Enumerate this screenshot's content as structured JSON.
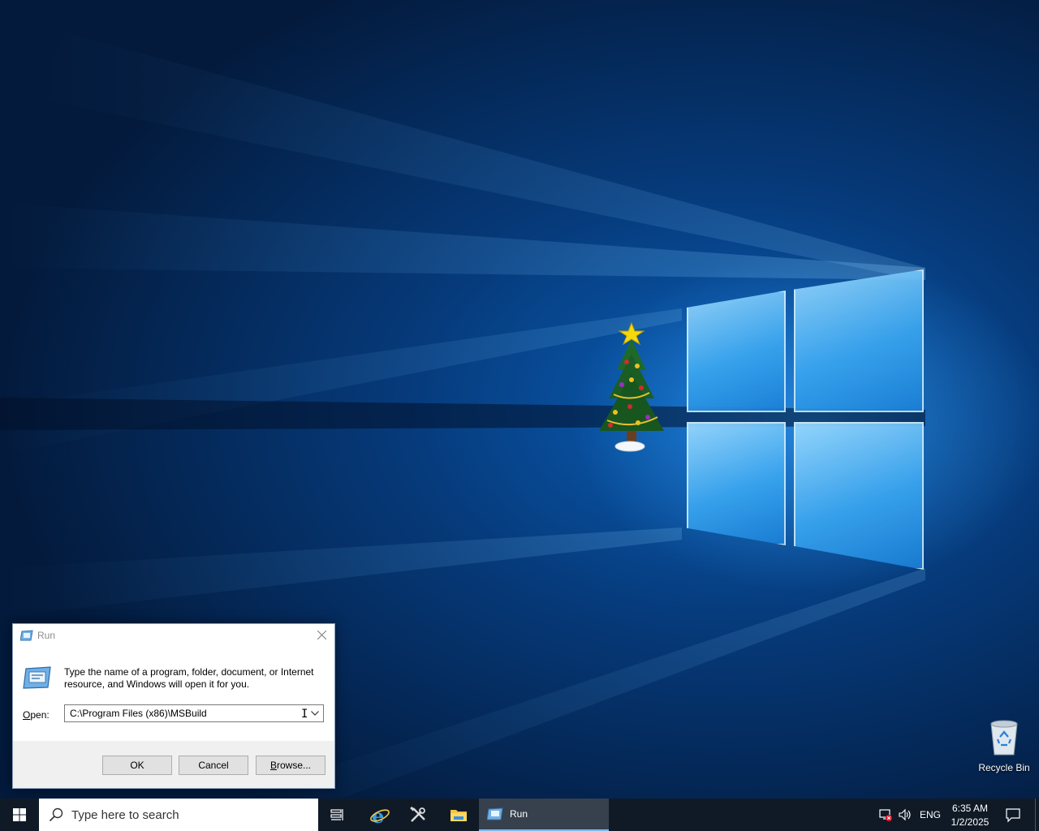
{
  "desktop": {
    "icons": [
      {
        "name": "recycle-bin",
        "label": "Recycle Bin"
      }
    ]
  },
  "run_dialog": {
    "title": "Run",
    "description": "Type the name of a program, folder, document, or Internet resource, and Windows will open it for you.",
    "open_label_prefix": "O",
    "open_label_rest": "pen:",
    "open_value": "C:\\Program Files (x86)\\MSBuild",
    "buttons": {
      "ok": "OK",
      "cancel": "Cancel",
      "browse_underlined": "B",
      "browse_rest": "rowse..."
    }
  },
  "taskbar": {
    "search_placeholder": "Type here to search",
    "pinned": [
      "task-view",
      "internet-explorer",
      "server-manager-tools",
      "file-explorer"
    ],
    "active_window": "Run",
    "tray": {
      "language": "ENG",
      "time": "6:35 AM",
      "date": "1/2/2025"
    }
  },
  "colors": {
    "taskbar_bg": "#101a27",
    "active_task_bg": "#37404d",
    "active_task_underline": "#76b9ed",
    "dialog_bg": "#f0f0f0"
  }
}
